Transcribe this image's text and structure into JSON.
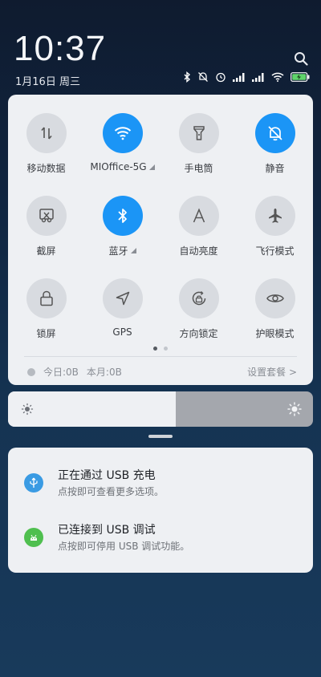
{
  "status": {
    "time": "10:37",
    "date": "1月16日 周三"
  },
  "colors": {
    "accent": "#1b95f6",
    "tile_off": "#d8dbe0",
    "panel_bg": "#eef0f3",
    "usb_icon": "#3a9be3",
    "adb_icon": "#4fbf4f"
  },
  "toggles": [
    {
      "label": "移动数据",
      "icon": "swap-vert-icon",
      "on": false
    },
    {
      "label": "MIOffice-5G",
      "icon": "wifi-icon",
      "on": true,
      "expand": true
    },
    {
      "label": "手电筒",
      "icon": "flashlight-icon",
      "on": false
    },
    {
      "label": "静音",
      "icon": "bell-off-icon",
      "on": true
    },
    {
      "label": "截屏",
      "icon": "scissors-icon",
      "on": false
    },
    {
      "label": "蓝牙",
      "icon": "bluetooth-icon",
      "on": true,
      "expand": true
    },
    {
      "label": "自动亮度",
      "icon": "brightness-auto-icon",
      "on": false
    },
    {
      "label": "飞行模式",
      "icon": "airplane-icon",
      "on": false
    },
    {
      "label": "锁屏",
      "icon": "lock-icon",
      "on": false
    },
    {
      "label": "GPS",
      "icon": "navigation-icon",
      "on": false
    },
    {
      "label": "方向锁定",
      "icon": "rotation-lock-icon",
      "on": false
    },
    {
      "label": "护眼模式",
      "icon": "eye-icon",
      "on": false
    }
  ],
  "data_usage": {
    "today": "今日:0B",
    "month": "本月:0B",
    "settings": "设置套餐 >"
  },
  "brightness": {
    "level": 0.55
  },
  "notifications": [
    {
      "title": "正在通过 USB 充电",
      "subtitle": "点按即可查看更多选项。",
      "icon": "usb-icon"
    },
    {
      "title": "已连接到 USB 调试",
      "subtitle": "点按即可停用 USB 调试功能。",
      "icon": "android-icon"
    }
  ]
}
